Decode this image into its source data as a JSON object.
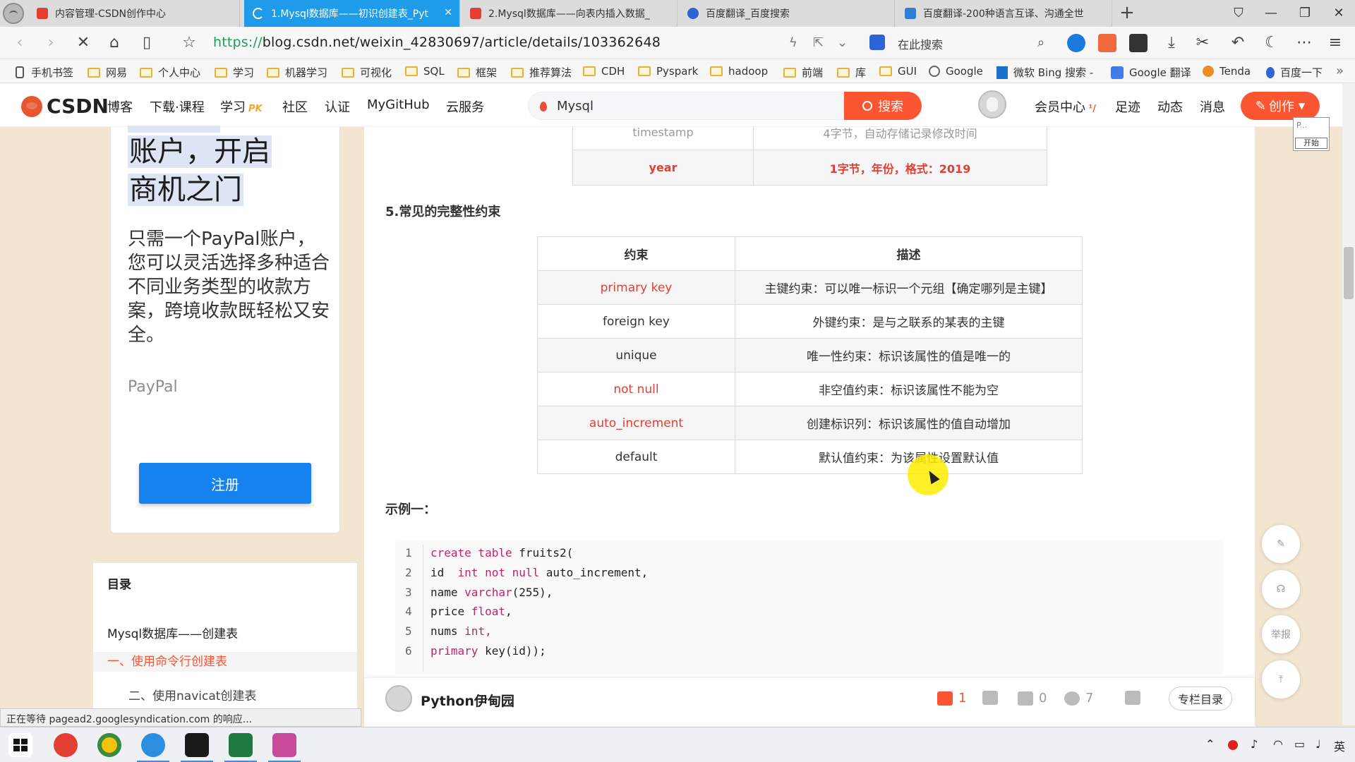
{
  "browser": {
    "tabs": [
      {
        "title": "内容管理-CSDN创作中心",
        "icon": "csdn-favicon",
        "active": false
      },
      {
        "title": "1.Mysql数据库——初识创建表_Pyt",
        "icon": "loading-spinner",
        "active": true
      },
      {
        "title": "2.Mysql数据库——向表内插入数据_",
        "icon": "csdn-favicon",
        "active": false
      },
      {
        "title": "百度翻译_百度搜索",
        "icon": "baidu-favicon",
        "active": false
      },
      {
        "title": "百度翻译-200种语言互译、沟通全世",
        "icon": "translate-favicon",
        "active": false
      }
    ],
    "url_scheme": "https://",
    "url_rest": "blog.csdn.net/weixin_42830697/article/details/103362648",
    "search_placeholder": "在此搜索",
    "bookmarks": [
      {
        "label": "手机书签",
        "icon": "phone-icon"
      },
      {
        "label": "网易",
        "icon": "folder-icon"
      },
      {
        "label": "个人中心",
        "icon": "folder-icon"
      },
      {
        "label": "学习",
        "icon": "folder-icon"
      },
      {
        "label": "机器学习",
        "icon": "folder-icon"
      },
      {
        "label": "可视化",
        "icon": "folder-icon"
      },
      {
        "label": "SQL",
        "icon": "folder-icon"
      },
      {
        "label": "框架",
        "icon": "folder-icon"
      },
      {
        "label": "推荐算法",
        "icon": "folder-icon"
      },
      {
        "label": "CDH",
        "icon": "folder-icon"
      },
      {
        "label": "Pyspark",
        "icon": "folder-icon"
      },
      {
        "label": "hadoop",
        "icon": "folder-icon"
      },
      {
        "label": "前端",
        "icon": "folder-icon"
      },
      {
        "label": "库",
        "icon": "folder-icon"
      },
      {
        "label": "GUI",
        "icon": "folder-icon"
      },
      {
        "label": "Google",
        "icon": "globe-icon"
      },
      {
        "label": "微软 Bing 搜索 -",
        "icon": "bing-icon"
      },
      {
        "label": "Google 翻译",
        "icon": "google-translate-icon"
      },
      {
        "label": "Tenda",
        "icon": "tenda-icon"
      },
      {
        "label": "百度一下",
        "icon": "baidu-icon"
      }
    ]
  },
  "csdn": {
    "logo_text": "CSDN",
    "nav": [
      "博客",
      "下载·课程",
      "学习",
      "社区",
      "认证",
      "MyGitHub",
      "云服务"
    ],
    "nav_badge": "PK",
    "search_value": "Mysql",
    "search_button": "搜索",
    "header_links": [
      "会员中心",
      "足迹",
      "动态",
      "消息"
    ],
    "create_button": "创作",
    "mini_popup": {
      "line1": "P...",
      "line2": "开始"
    }
  },
  "ad": {
    "headline_line1": "账户，开启",
    "headline_line2": "商机之门",
    "body": "只需一个PayPal账户，您可以灵活选择多种适合不同业务类型的收款方案，跨境收款既轻松又安全。",
    "brand": "PayPal",
    "button": "注册"
  },
  "toc": {
    "title": "目录",
    "items": [
      {
        "label": "Mysql数据库——创建表",
        "level": 1,
        "active": false
      },
      {
        "label": "一、使用命令行创建表",
        "level": 2,
        "active": true
      },
      {
        "label": "二、使用navicat创建表",
        "level": 3,
        "active": false
      }
    ]
  },
  "article": {
    "type_table": {
      "partial_row": {
        "name": "timestamp",
        "desc": "4字节，自动存储记录修改时间"
      },
      "row": {
        "name": "year",
        "desc": "1字节，年份，格式：2019"
      }
    },
    "section5_title": "5.常见的完整性约束",
    "constraints": {
      "headers": [
        "约束",
        "描述"
      ],
      "rows": [
        {
          "name": "primary key",
          "desc": "主键约束：可以唯一标识一个元组【确定哪列是主键】",
          "highlight": true
        },
        {
          "name": "foreign key",
          "desc": "外键约束：是与之联系的某表的主键",
          "highlight": false
        },
        {
          "name": "unique",
          "desc": "唯一性约束：标识该属性的值是唯一的",
          "highlight": false
        },
        {
          "name": "not null",
          "desc": "非空值约束：标识该属性不能为空",
          "highlight": true
        },
        {
          "name": "auto_increment",
          "desc": "创建标识列：标识该属性的值自动增加",
          "highlight": true
        },
        {
          "name": "default",
          "desc": "默认值约束：为该属性设置默认值",
          "highlight": false
        }
      ]
    },
    "example_title": "示例一：",
    "code_lines": [
      {
        "n": "1",
        "text": "create table fruits2("
      },
      {
        "n": "2",
        "text": "id  int not null auto_increment,"
      },
      {
        "n": "3",
        "text": "name varchar(255),"
      },
      {
        "n": "4",
        "text": "price float,"
      },
      {
        "n": "5",
        "text": "nums int,"
      },
      {
        "n": "6",
        "text": "primary key(id));"
      }
    ]
  },
  "author_bar": {
    "name": "Python伊甸园",
    "likes": "1",
    "comments": "0",
    "favorites": "7",
    "column_button": "专栏目录"
  },
  "float_tools": [
    "edit-icon",
    "headset-icon",
    "举报",
    "back-to-top-icon"
  ],
  "status_text": "正在等待 pagead2.googlesyndication.com 的响应...",
  "taskbar": {
    "tray_ime": "英"
  },
  "colors": {
    "accent": "#fc5531",
    "tab_active": "#1e9be9",
    "ad_button": "#1682f0",
    "highlight_red": "#e33e33"
  }
}
